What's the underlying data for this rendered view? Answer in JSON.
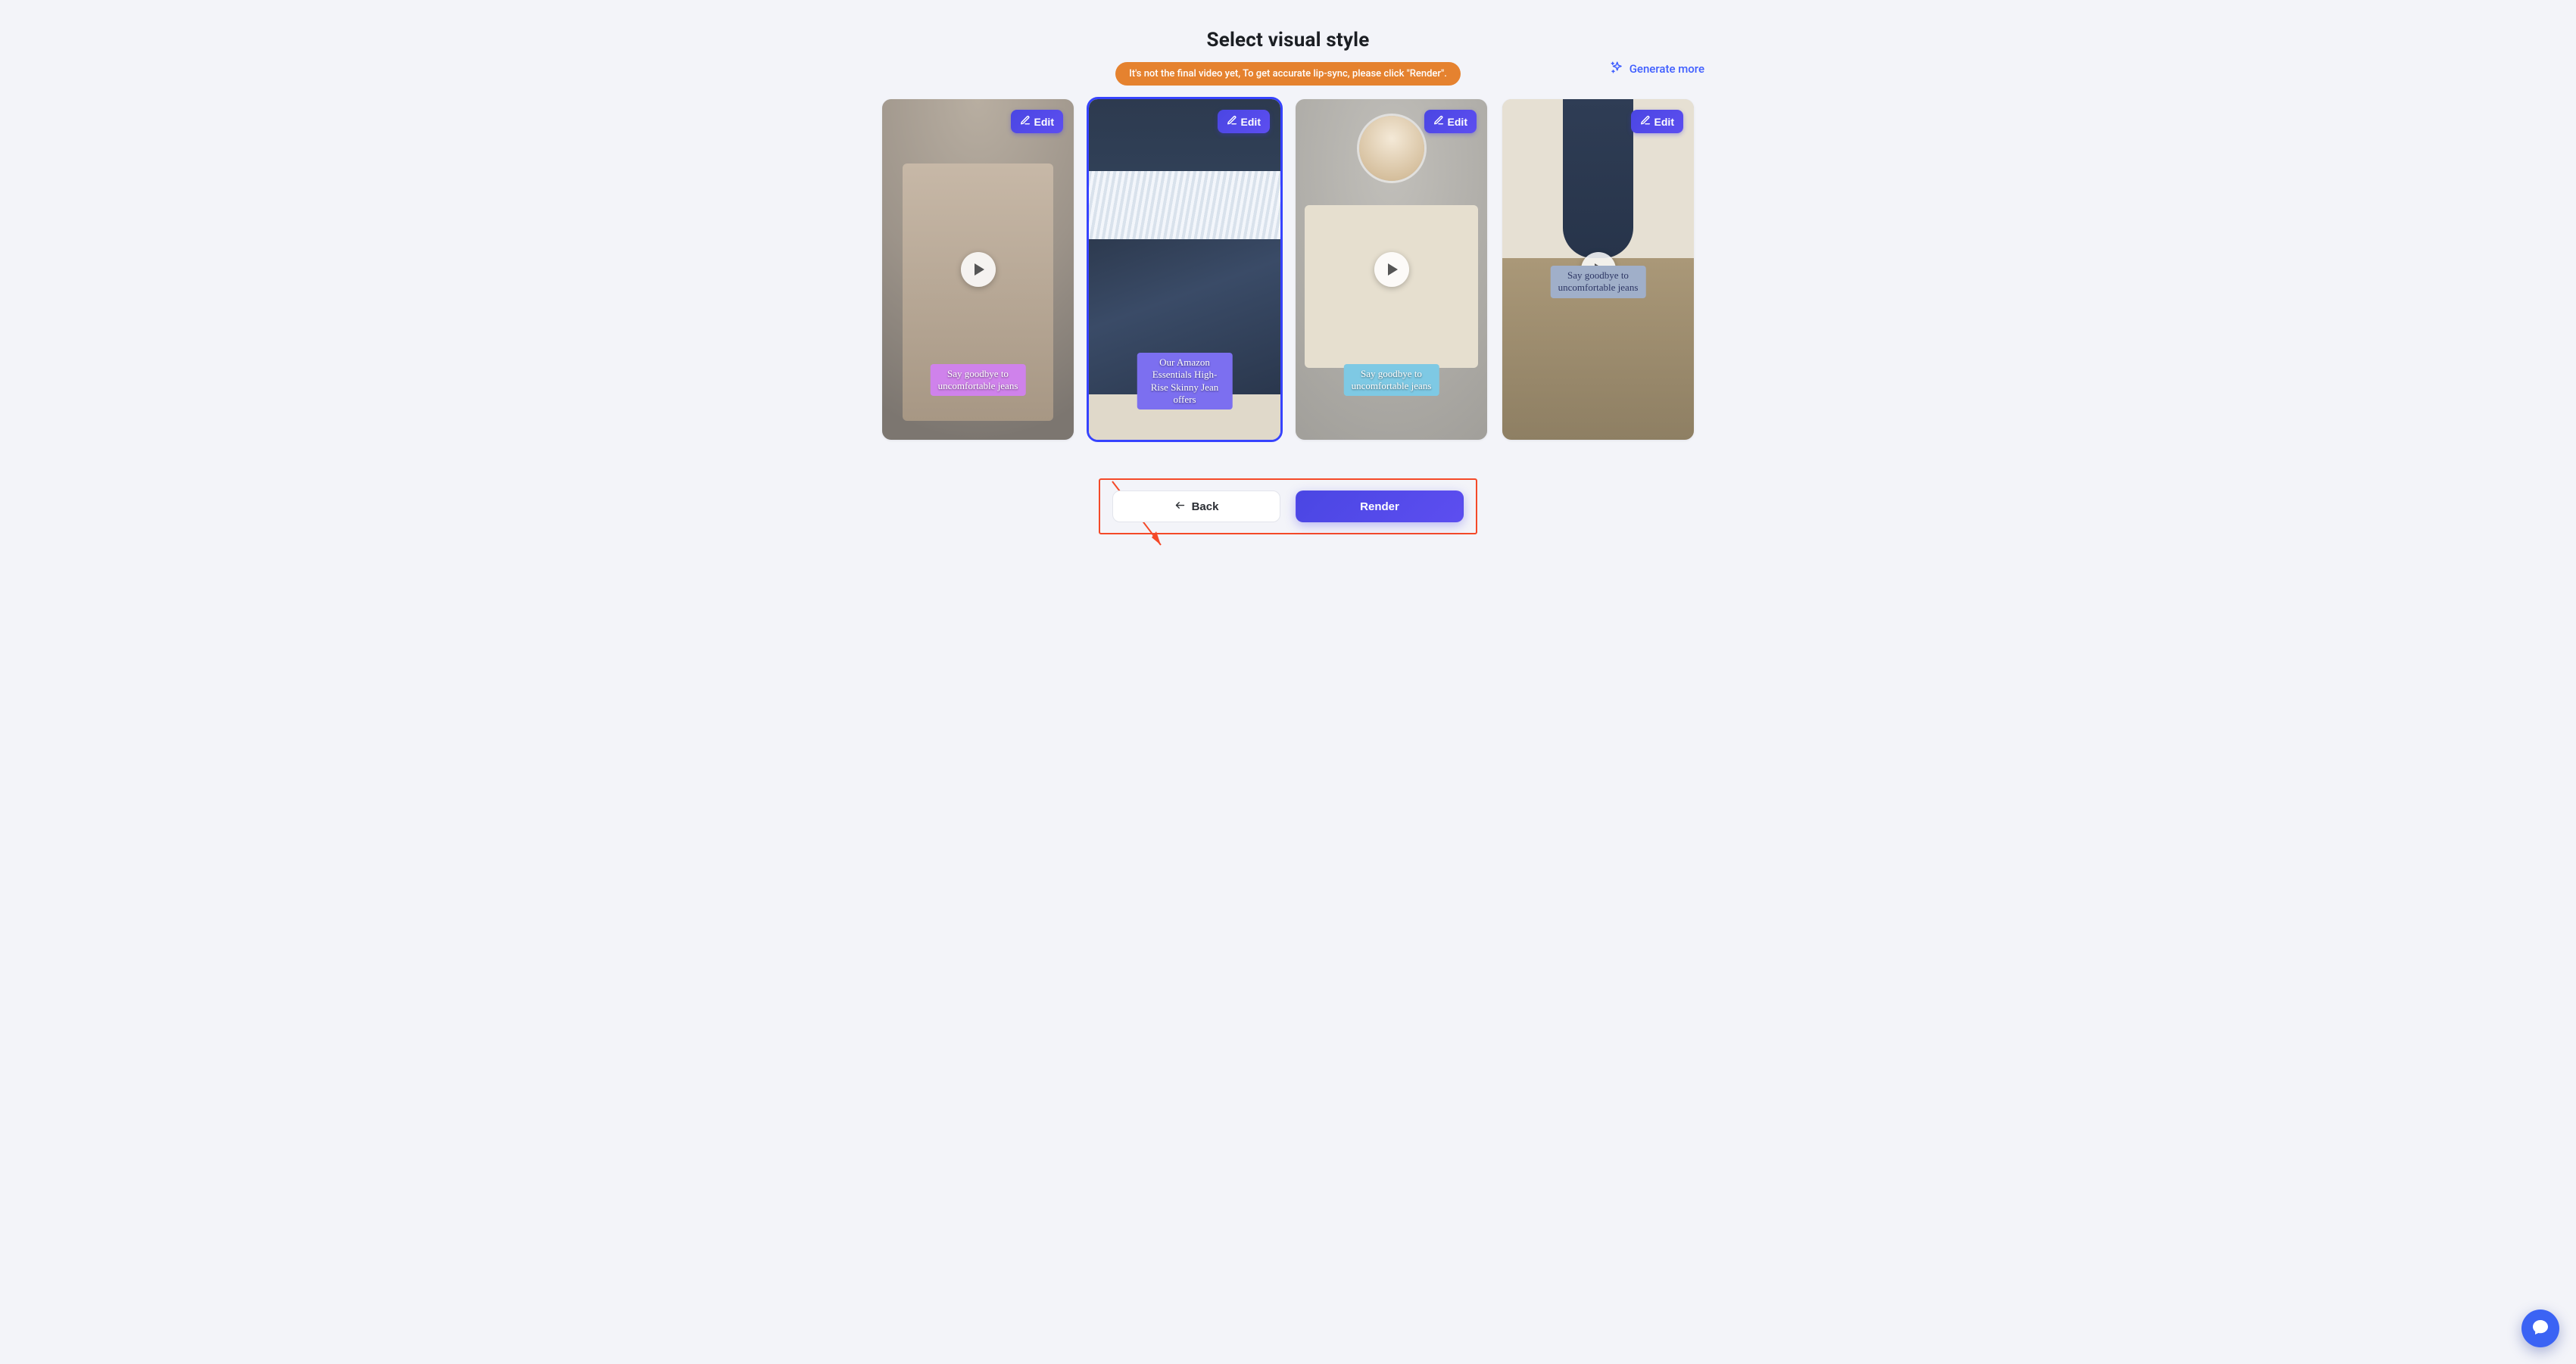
{
  "page": {
    "title": "Select visual style",
    "notice": "It's not the final video yet, To get accurate lip-sync, please click \"Render\".",
    "generate_more": "Generate more"
  },
  "cards": [
    {
      "edit_label": "Edit",
      "caption": "Say goodbye to uncomfortable jeans",
      "selected": false,
      "has_play": true,
      "caption_style": "bg-pink"
    },
    {
      "edit_label": "Edit",
      "caption": "Our Amazon Essentials High-Rise Skinny Jean offers",
      "selected": true,
      "has_play": false,
      "caption_style": "bg-purple"
    },
    {
      "edit_label": "Edit",
      "caption": "Say goodbye to uncomfortable jeans",
      "selected": false,
      "has_play": true,
      "caption_style": "bg-teal"
    },
    {
      "edit_label": "Edit",
      "caption": "Say goodbye to uncomfortable jeans",
      "selected": false,
      "has_play": true,
      "caption_style": "bg-steel"
    }
  ],
  "actions": {
    "back": "Back",
    "render": "Render"
  }
}
